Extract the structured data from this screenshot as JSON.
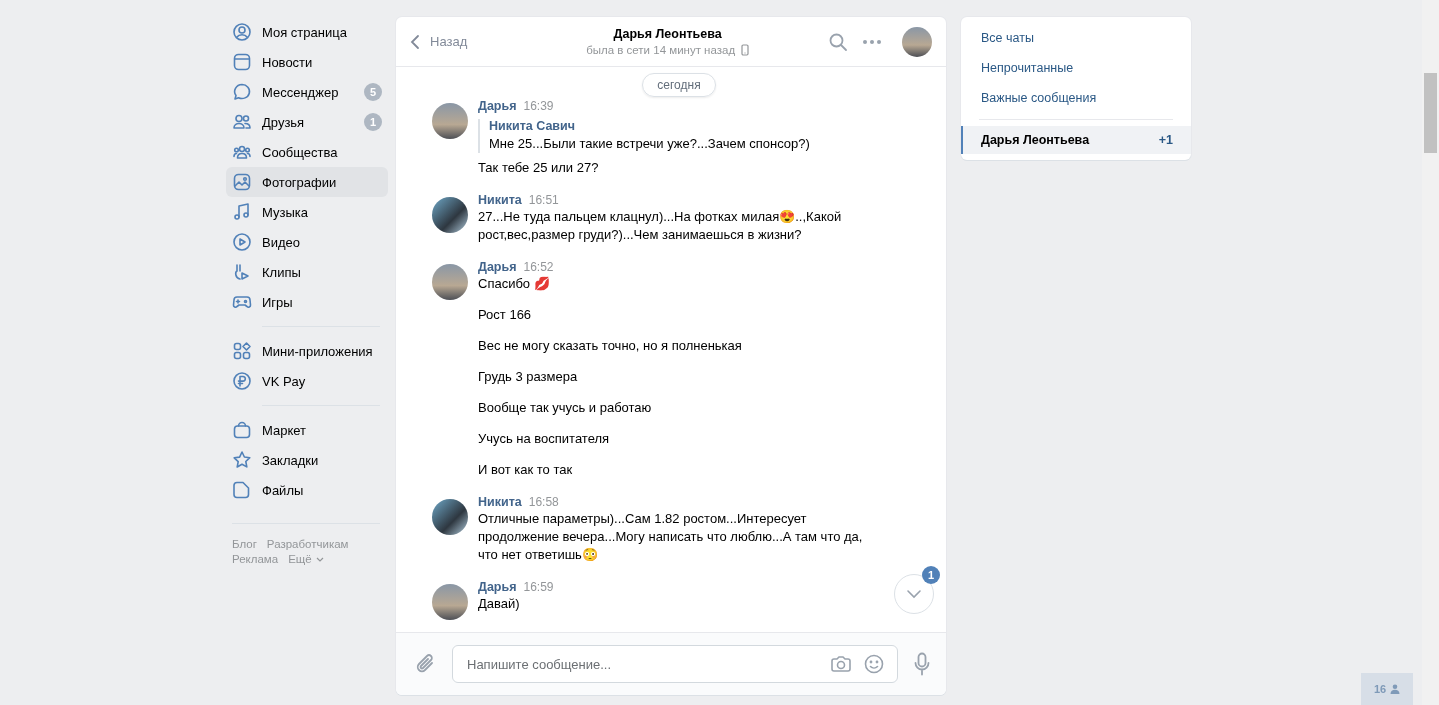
{
  "sidebar": {
    "groups": [
      [
        {
          "label": "Моя страница",
          "selected": false
        },
        {
          "label": "Новости",
          "selected": false
        },
        {
          "label": "Мессенджер",
          "badge": "5",
          "selected": false
        },
        {
          "label": "Друзья",
          "badge": "1",
          "selected": false
        },
        {
          "label": "Сообщества",
          "selected": false
        },
        {
          "label": "Фотографии",
          "selected": true
        },
        {
          "label": "Музыка",
          "selected": false
        },
        {
          "label": "Видео",
          "selected": false
        },
        {
          "label": "Клипы",
          "selected": false
        },
        {
          "label": "Игры",
          "selected": false
        }
      ],
      [
        {
          "label": "Мини-приложения",
          "selected": false
        },
        {
          "label": "VK Pay",
          "selected": false
        }
      ],
      [
        {
          "label": "Маркет",
          "selected": false
        },
        {
          "label": "Закладки",
          "selected": false
        },
        {
          "label": "Файлы",
          "selected": false
        }
      ]
    ],
    "footer_links": [
      "Блог",
      "Разработчикам",
      "Реклама",
      "Ещё"
    ]
  },
  "chat": {
    "back": "Назад",
    "title": "Дарья Леонтьева",
    "status": "была в сети 14 минут назад",
    "date_chip": "сегодня",
    "messages": [
      {
        "author": "Дарья",
        "time": "16:39",
        "quote": {
          "author": "Никита Савич",
          "text": "Мне 25...Были такие встречи уже?...Зачем спонсор?)"
        },
        "paragraphs": [
          "Так тебе 25 или 27?"
        ]
      },
      {
        "author": "Никита",
        "time": "16:51",
        "paragraphs": [
          "27...Не туда пальцем клацнул)...На фотках милая😍..,Какой рост,вес,размер груди?)...Чем занимаешься в жизни?"
        ]
      },
      {
        "author": "Дарья",
        "time": "16:52",
        "paragraphs": [
          "Спасибо 💋",
          "Рост 166",
          "Вес не могу сказать точно, но я полненькая",
          "Грудь 3 размера",
          "Вообще так учусь и работаю",
          "Учусь на воспитателя",
          "И вот как то так"
        ]
      },
      {
        "author": "Никита",
        "time": "16:58",
        "paragraphs": [
          "Отличные параметры)...Сам 1.82 ростом...Интересует продолжение вечера...Могу написать что люблю...А там что да, что нет ответишь😳"
        ]
      },
      {
        "author": "Дарья",
        "time": "16:59",
        "paragraphs": [
          "Давай)"
        ]
      }
    ],
    "unread_badge": "1",
    "composer": {
      "placeholder": "Напишите сообщение..."
    }
  },
  "right_panel": {
    "filters": [
      {
        "label": "Все чаты",
        "selected": false
      },
      {
        "label": "Непрочитанные",
        "selected": false
      },
      {
        "label": "Важные сообщения",
        "selected": false
      }
    ],
    "conversations": [
      {
        "name": "Дарья Леонтьева",
        "count": "+1",
        "selected": true
      }
    ]
  },
  "online_counter": "16"
}
